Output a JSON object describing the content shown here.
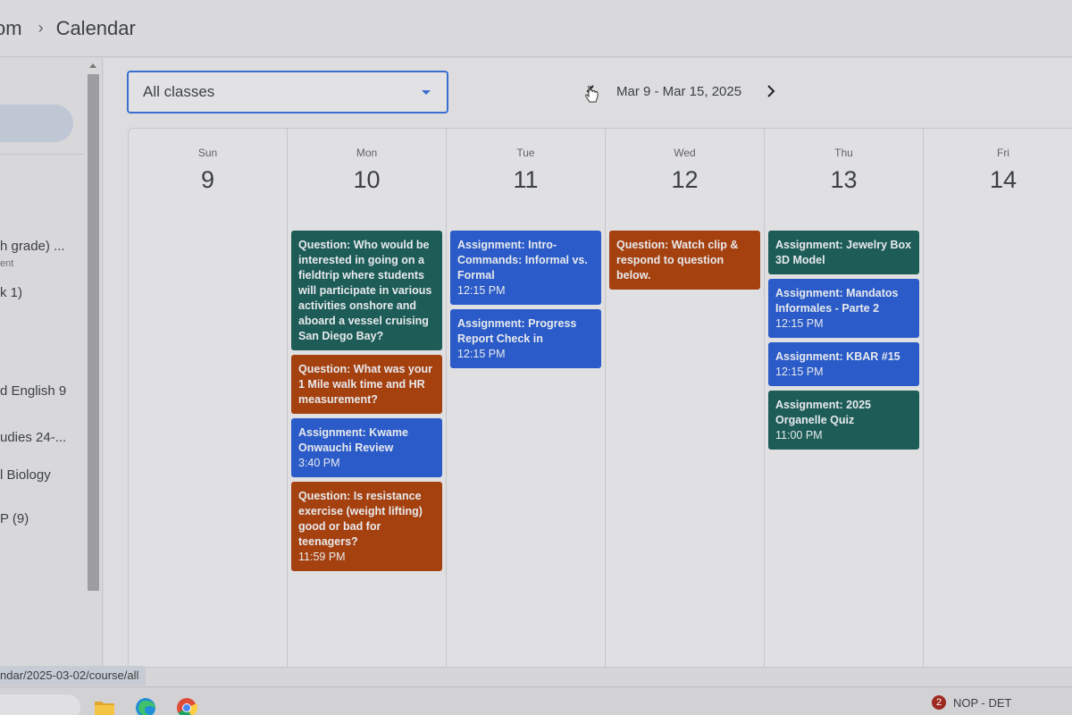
{
  "breadcrumb": {
    "parent": "om",
    "separator": "›",
    "current": "Calendar"
  },
  "sidebar": {
    "items": [
      {
        "label": "h grade) ...",
        "sub": "ent"
      },
      {
        "label": "k 1)"
      },
      {
        "label": "d English 9"
      },
      {
        "label": "udies 24-..."
      },
      {
        "label": "l Biology"
      },
      {
        "label": "P (9)"
      }
    ]
  },
  "filter": {
    "selected": "All classes"
  },
  "week_nav": {
    "label": "Mar 9 - Mar 15, 2025",
    "prev_icon": "chevron-left-icon",
    "next_icon": "chevron-right-icon"
  },
  "colors": {
    "teal": "#1d5c57",
    "brown": "#a5400f",
    "blue": "#2a5bc8",
    "accent": "#3a6fd0"
  },
  "days": [
    {
      "name": "Sun",
      "num": "9",
      "events": []
    },
    {
      "name": "Mon",
      "num": "10",
      "events": [
        {
          "title": "Question: Who would be interested in going on a fieldtrip where students will participate in various activities onshore and aboard a vessel cruising San Diego Bay?",
          "time": "",
          "color": "teal"
        },
        {
          "title": "Question: What was your 1 Mile walk time and HR measurement?",
          "time": "",
          "color": "brown"
        },
        {
          "title": "Assignment: Kwame Onwauchi Review",
          "time": "3:40 PM",
          "color": "blue"
        },
        {
          "title": "Question: Is resistance exercise (weight lifting) good or bad for teenagers?",
          "time": "11:59 PM",
          "color": "brown"
        }
      ]
    },
    {
      "name": "Tue",
      "num": "11",
      "events": [
        {
          "title": "Assignment: Intro-Commands: Informal vs. Formal",
          "time": "12:15 PM",
          "color": "blue"
        },
        {
          "title": "Assignment: Progress Report Check in",
          "time": "12:15 PM",
          "color": "blue"
        }
      ]
    },
    {
      "name": "Wed",
      "num": "12",
      "events": [
        {
          "title": "Question: Watch clip & respond to question below.",
          "time": "",
          "color": "brown"
        }
      ]
    },
    {
      "name": "Thu",
      "num": "13",
      "events": [
        {
          "title": "Assignment: Jewelry Box 3D Model",
          "time": "",
          "color": "teal"
        },
        {
          "title": "Assignment: Mandatos Informales - Parte 2",
          "time": "12:15 PM",
          "color": "blue"
        },
        {
          "title": "Assignment: KBAR #15",
          "time": "12:15 PM",
          "color": "blue"
        },
        {
          "title": "Assignment: 2025 Organelle Quiz",
          "time": "11:00 PM",
          "color": "teal"
        }
      ]
    },
    {
      "name": "Fri",
      "num": "14",
      "events": []
    }
  ],
  "status_url": "ndar/2025-03-02/course/all",
  "taskbar": {
    "apps": [
      "file-explorer-icon",
      "edge-icon",
      "chrome-icon"
    ],
    "tray_badge": "2",
    "tray_label": "NOP - DET"
  }
}
